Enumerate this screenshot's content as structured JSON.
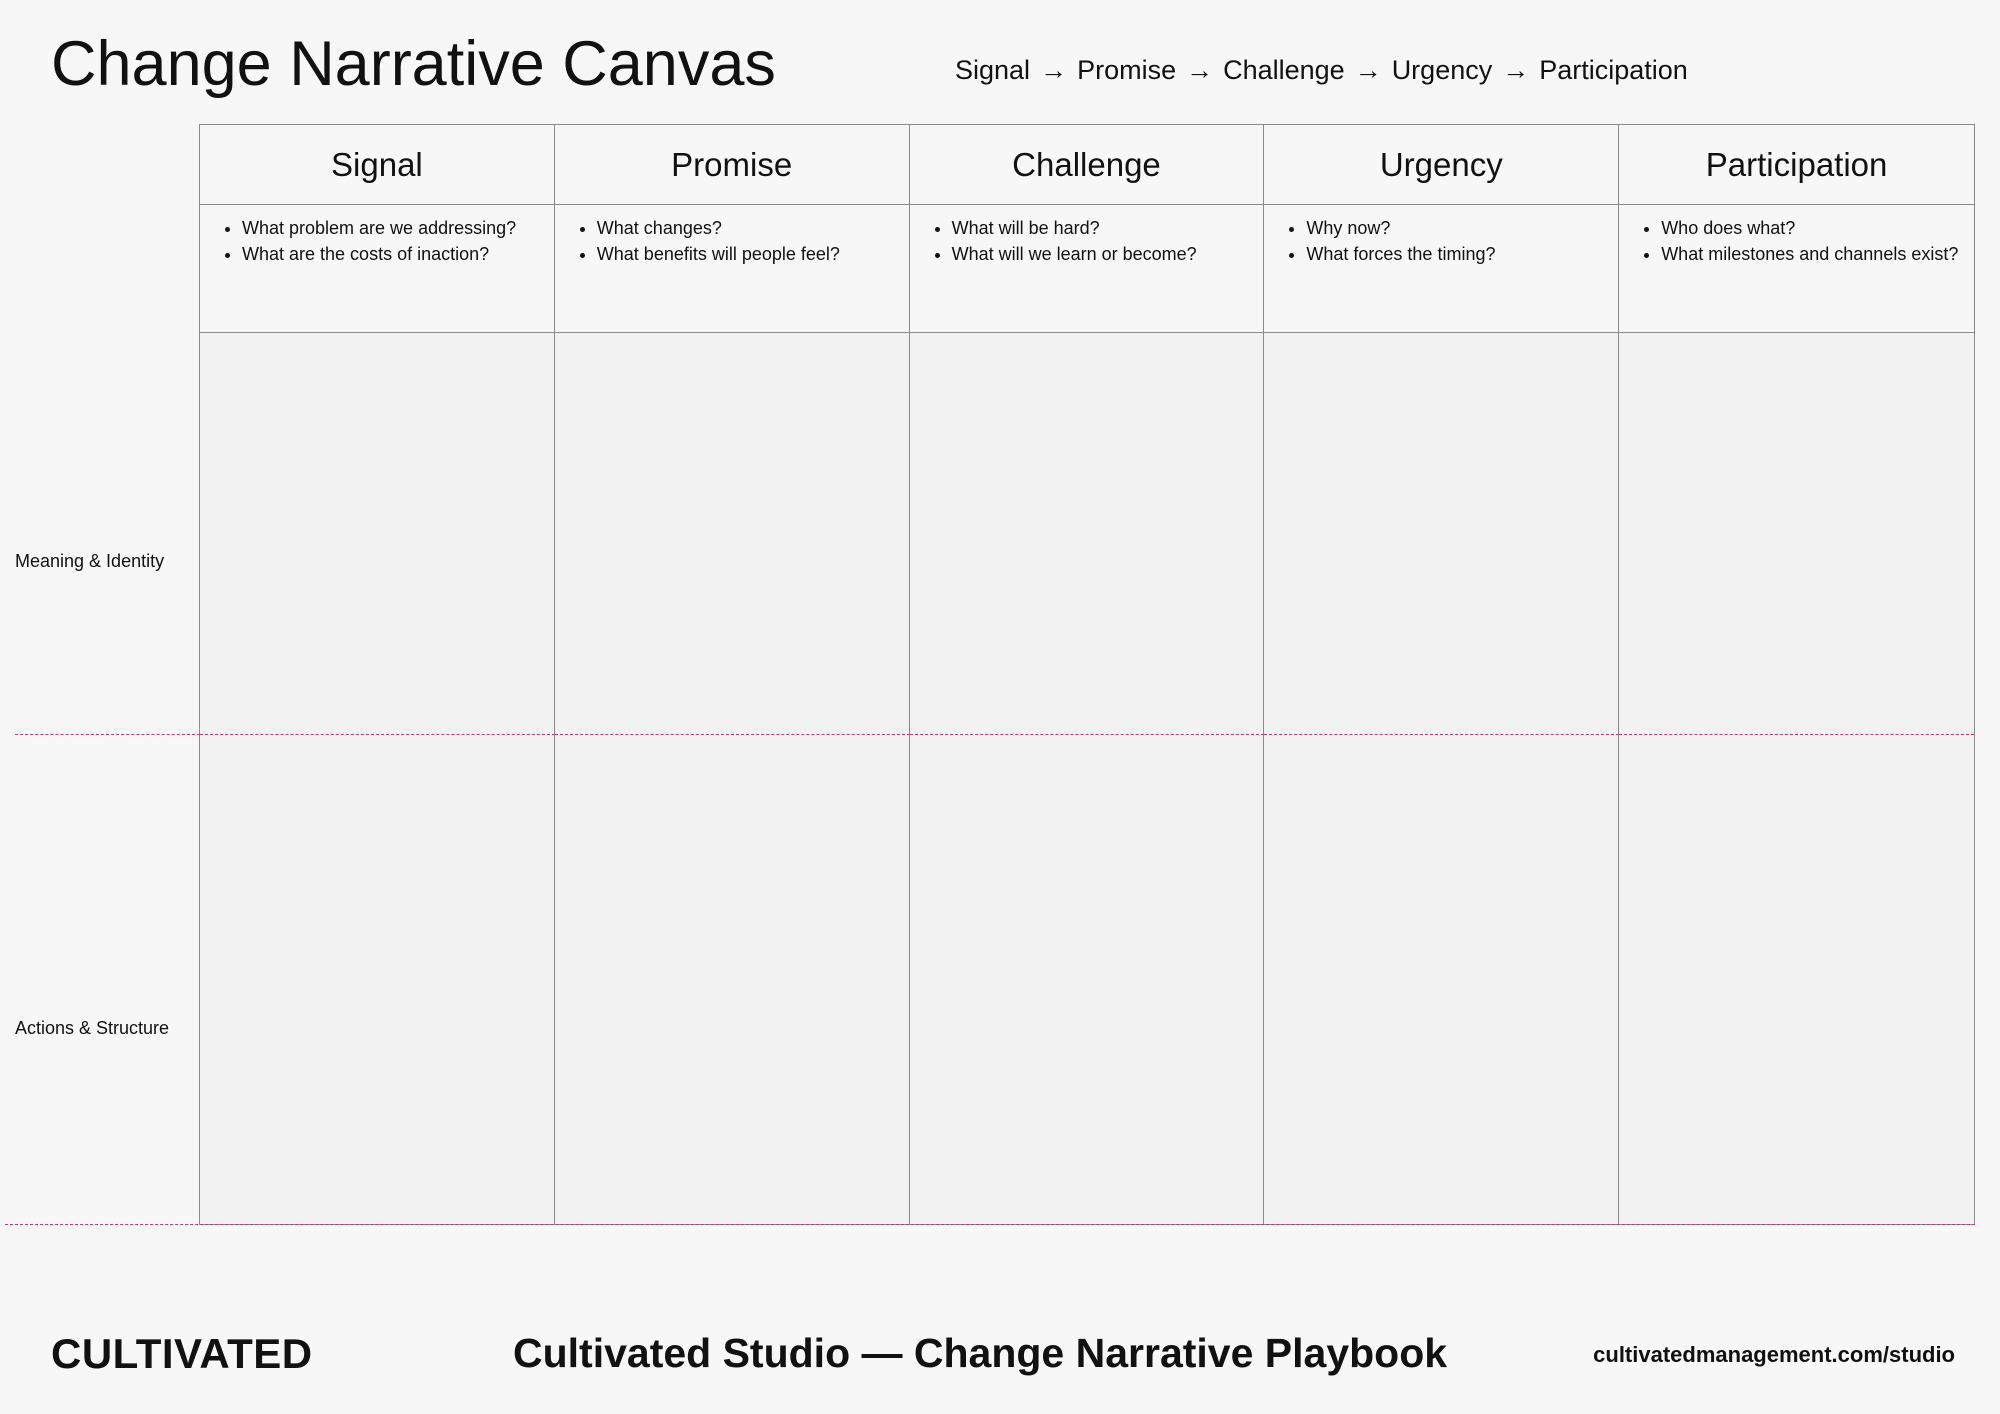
{
  "title": "Change Narrative Canvas",
  "flow": [
    "Signal",
    "Promise",
    "Challenge",
    "Urgency",
    "Participation"
  ],
  "flow_arrow": "→",
  "columns": [
    {
      "label": "Signal",
      "prompts": [
        "What problem are we addressing?",
        "What are the costs of inaction?"
      ]
    },
    {
      "label": "Promise",
      "prompts": [
        "What changes?",
        "What benefits will people feel?"
      ]
    },
    {
      "label": "Challenge",
      "prompts": [
        "What will be hard?",
        "What will we learn or become?"
      ]
    },
    {
      "label": "Urgency",
      "prompts": [
        "Why now?",
        "What forces the timing?"
      ]
    },
    {
      "label": "Participation",
      "prompts": [
        "Who does what?",
        "What milestones and channels exist?"
      ]
    }
  ],
  "rows": [
    "Meaning & Identity",
    "Actions & Structure"
  ],
  "footer": {
    "brand": "CULTIVATED",
    "title": "Cultivated Studio — Change Narrative Playbook",
    "url": "cultivatedmanagement.com/studio"
  },
  "colors": {
    "background": "#f7f7f7",
    "cell_fill": "#f2f2f2",
    "grid_line": "#8a8a8a",
    "row_divider": "#c0406a"
  }
}
